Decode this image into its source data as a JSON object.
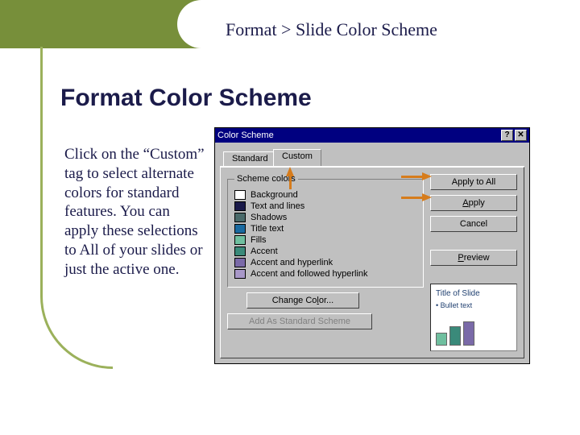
{
  "breadcrumb": "Format > Slide Color Scheme",
  "heading": "Format Color Scheme",
  "description": "Click on the “Custom” tag to select alternate colors for standard features.  You can apply these selections to All of your slides or just the active one.",
  "dialog": {
    "title": "Color Scheme",
    "help_btn": "?",
    "close_btn": "✕",
    "tabs": {
      "standard": "Standard",
      "custom": "Custom"
    },
    "group_label": "Scheme colors",
    "swatches": [
      {
        "color": "#ffffff",
        "label": "Background"
      },
      {
        "color": "#1a1a4a",
        "label": "Text and lines"
      },
      {
        "color": "#4a6a6a",
        "label": "Shadows"
      },
      {
        "color": "#1a6aa0",
        "label": "Title text"
      },
      {
        "color": "#6fbf9f",
        "label": "Fills"
      },
      {
        "color": "#3a8a7a",
        "label": "Accent"
      },
      {
        "color": "#7a6aa8",
        "label": "Accent and hyperlink"
      },
      {
        "color": "#a898c8",
        "label": "Accent and followed hyperlink"
      }
    ],
    "buttons": {
      "change_color_pre": "Change Co",
      "change_color_accel": "l",
      "change_color_post": "or...",
      "add_scheme": "Add As Standard Scheme",
      "apply_all": "Apply to All",
      "apply_accel": "A",
      "apply_post": "pply",
      "cancel": "Cancel",
      "preview_accel": "P",
      "preview_post": "review"
    },
    "preview": {
      "title": "Title of Slide",
      "bullet": "• Bullet text",
      "bars": [
        {
          "h": 16,
          "c": "#6fbf9f"
        },
        {
          "h": 24,
          "c": "#3a8a7a"
        },
        {
          "h": 30,
          "c": "#7a6aa8"
        }
      ]
    }
  }
}
